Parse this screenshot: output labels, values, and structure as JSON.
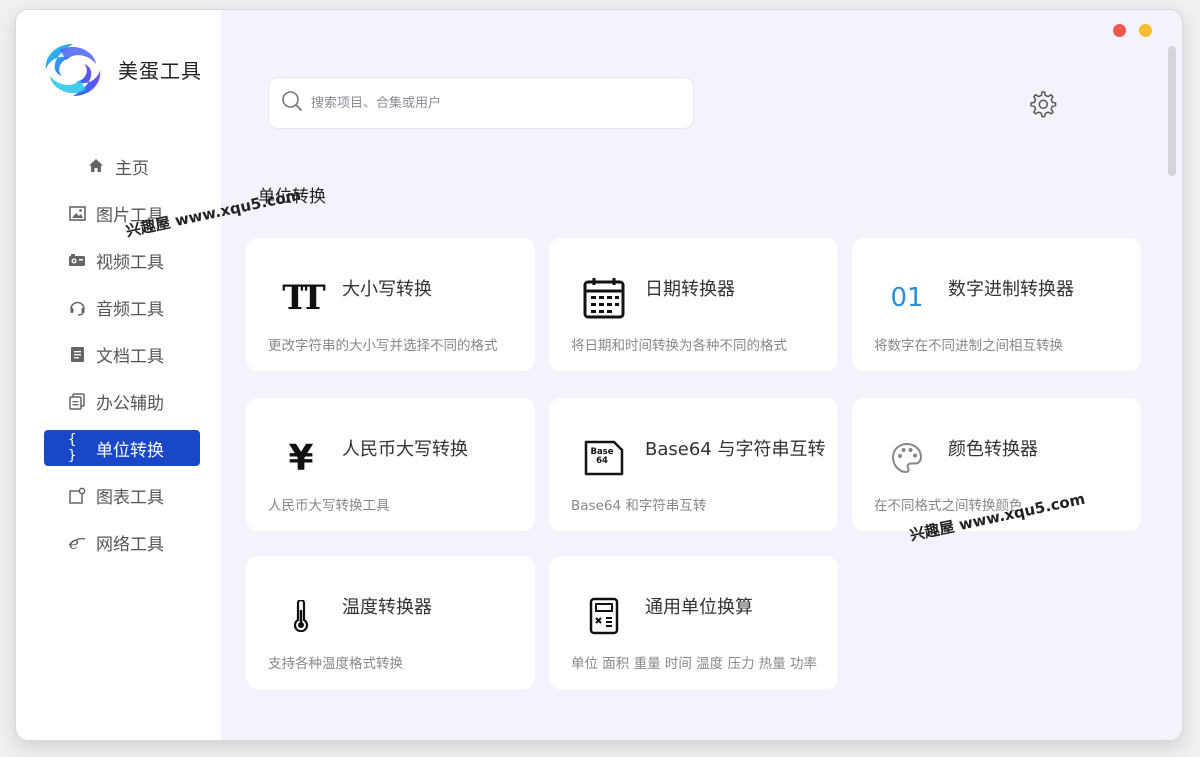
{
  "app": {
    "title": "美蛋工具"
  },
  "search": {
    "placeholder": "搜索项目、合集或用户"
  },
  "sidebar": {
    "items": [
      {
        "label": "主页",
        "icon": "home-icon"
      },
      {
        "label": "图片工具",
        "icon": "image-icon"
      },
      {
        "label": "视频工具",
        "icon": "video-icon"
      },
      {
        "label": "音频工具",
        "icon": "headphones-icon"
      },
      {
        "label": "文档工具",
        "icon": "document-icon"
      },
      {
        "label": "办公辅助",
        "icon": "copy-icon"
      },
      {
        "label": "单位转换",
        "icon": "braces-icon",
        "active": true
      },
      {
        "label": "图表工具",
        "icon": "chart-icon"
      },
      {
        "label": "网络工具",
        "icon": "browser-icon"
      }
    ]
  },
  "section": {
    "title": "单位转换"
  },
  "watermarks": [
    "兴趣屋 www.xqu5.com",
    "兴趣屋 www.xqu5.com"
  ],
  "cards": [
    {
      "title": "大小写转换",
      "desc": "更改字符串的大小写并选择不同的格式",
      "icon": "text-case-icon",
      "icon_text": "TT"
    },
    {
      "title": "日期转换器",
      "desc": "将日期和时间转换为各种不同的格式",
      "icon": "calendar-icon"
    },
    {
      "title": "数字进制转换器",
      "desc": "将数字在不同进制之间相互转换",
      "icon": "binary-icon",
      "icon_text": "01"
    },
    {
      "title": "人民币大写转换",
      "desc": "人民币大写转换工具",
      "icon": "yuan-icon",
      "icon_text": "¥"
    },
    {
      "title": "Base64 与字符串互转",
      "desc": "Base64 和字符串互转",
      "icon": "base64-file-icon",
      "icon_text": "Base 64"
    },
    {
      "title": "颜色转换器",
      "desc": "在不同格式之间转换颜色",
      "icon": "palette-icon"
    },
    {
      "title": "温度转换器",
      "desc": "支持各种温度格式转换",
      "icon": "thermometer-icon"
    },
    {
      "title": "通用单位换算",
      "desc": "单位 面积 重量 时间 温度 压力 热量 功率",
      "icon": "calculator-icon"
    }
  ],
  "colors": {
    "accent": "#1a47c7",
    "binary": "#2a8fd6"
  }
}
